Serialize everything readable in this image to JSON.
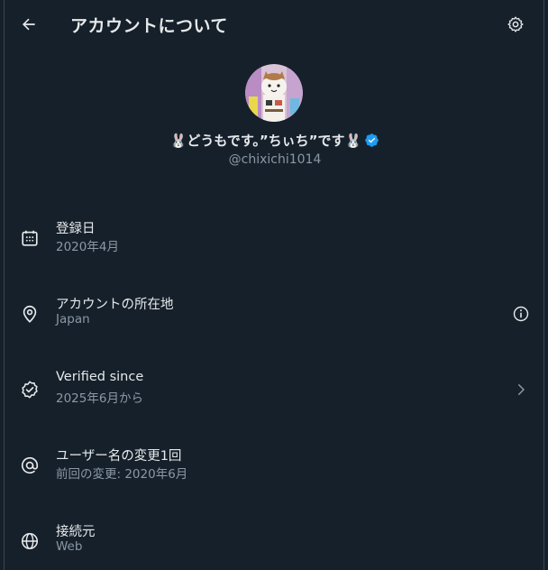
{
  "header": {
    "title": "アカウントについて"
  },
  "profile": {
    "display_name": "🐰どうもです。”ちぃち”です🐰",
    "handle": "@chixichi1014",
    "verified": true
  },
  "rows": [
    {
      "title": "登録日",
      "sub": "2020年4月",
      "icon": "calendar-icon"
    },
    {
      "title": "アカウントの所在地",
      "sub": "Japan",
      "icon": "location-pin-icon",
      "action": "info-icon"
    },
    {
      "title": "Verified since",
      "sub": "2025年6月から",
      "icon": "verified-badge-icon",
      "action": "chevron-right-icon"
    },
    {
      "title": "ユーザー名の変更1回",
      "sub": "前回の変更: 2020年6月",
      "icon": "at-sign-icon"
    },
    {
      "title": "接続元",
      "sub": "Web",
      "icon": "globe-icon"
    }
  ],
  "colors": {
    "background": "#15202b",
    "text_primary": "#e7e9ea",
    "text_secondary": "#8b98a5",
    "accent": "#1d9bf0",
    "border": "#38444d"
  }
}
